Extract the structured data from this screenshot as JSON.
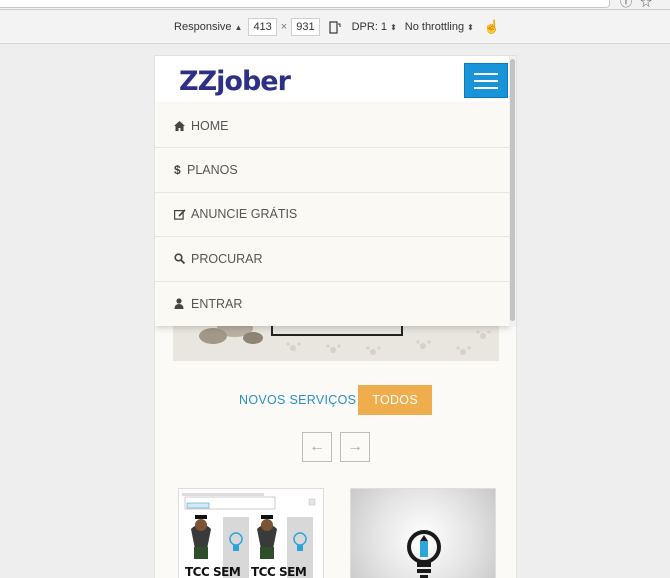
{
  "devtools": {
    "device": "Responsive",
    "width": "413",
    "times": "×",
    "height": "931",
    "dpr": "DPR: 1",
    "throttling": "No throttling"
  },
  "site": {
    "logo": "ZZjober"
  },
  "nav": {
    "items": [
      {
        "label": "HOME",
        "icon": "home-icon"
      },
      {
        "label": "PLANOS",
        "icon": "dollar-icon"
      },
      {
        "label": "ANUNCIE GRÁTIS",
        "icon": "edit-icon"
      },
      {
        "label": "PROCURAR",
        "icon": "search-icon"
      },
      {
        "label": "ENTRAR",
        "icon": "user-icon"
      }
    ]
  },
  "services": {
    "tab_new": "NOVOS SERVIÇOS",
    "tab_all": "TODOS",
    "prev": "←",
    "next": "→"
  },
  "cards": {
    "tcc_left": "TCC SEM",
    "tcc_right": "TCC SEM"
  },
  "colors": {
    "logo": "#2e2f87",
    "hamburger": "#1795d8",
    "tab_link": "#2a8fc7",
    "tab_active": "#f0ad4e"
  }
}
